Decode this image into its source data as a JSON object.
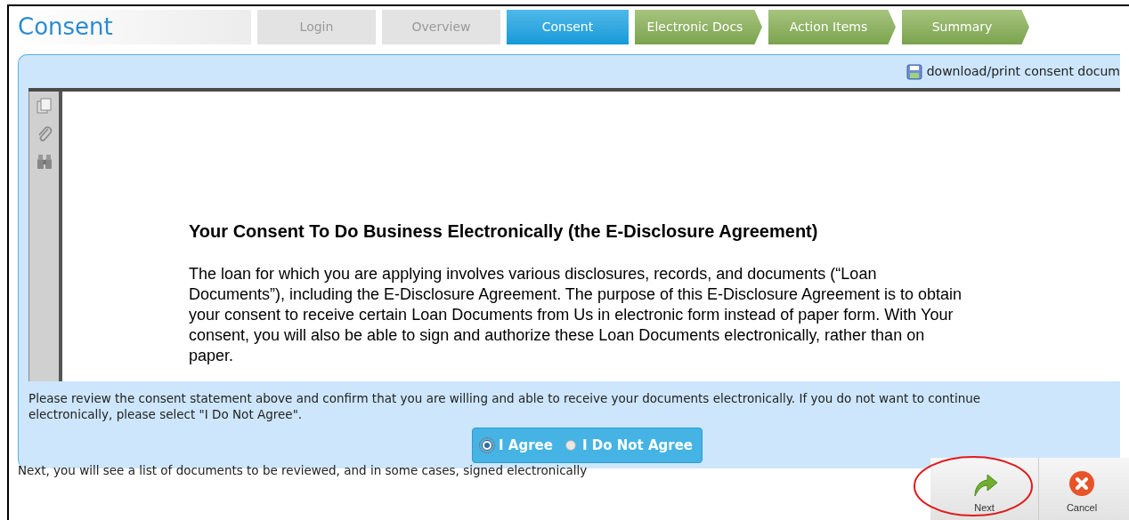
{
  "page_title": "Consent",
  "steps": [
    {
      "label": "Login",
      "kind": "done"
    },
    {
      "label": "Overview",
      "kind": "done"
    },
    {
      "label": "Consent",
      "kind": "current"
    },
    {
      "label": "Electronic Docs",
      "kind": "upcoming"
    },
    {
      "label": "Action Items",
      "kind": "upcoming"
    },
    {
      "label": "Summary",
      "kind": "upcoming"
    }
  ],
  "download_link": "download/print consent docum",
  "document": {
    "heading": "Your Consent To Do Business Electronically (the E-Disclosure Agreement)",
    "paragraph": "The loan for which you are applying involves various disclosures, records, and documents (“Loan Documents”), including the E-Disclosure Agreement.  The purpose of this E-Disclosure Agreement is to obtain your consent to receive certain Loan Documents from Us in electronic form instead of paper form. With Your consent, you will also be able to sign and authorize these Loan Documents electronically, rather than on paper."
  },
  "instructions": "Please review the consent statement above and confirm that you are willing and able to receive your documents electronically. If you do not want to continue electronically, please select \"I Do Not Agree\".",
  "options": [
    {
      "label": "I Agree",
      "selected": true
    },
    {
      "label": "I Do Not Agree",
      "selected": false
    }
  ],
  "next_note": "Next, you will see a list of documents to be reviewed, and in some cases, signed electronically",
  "actions": [
    {
      "label": "Next",
      "kind": "next"
    },
    {
      "label": "Cancel",
      "kind": "cancel"
    }
  ]
}
